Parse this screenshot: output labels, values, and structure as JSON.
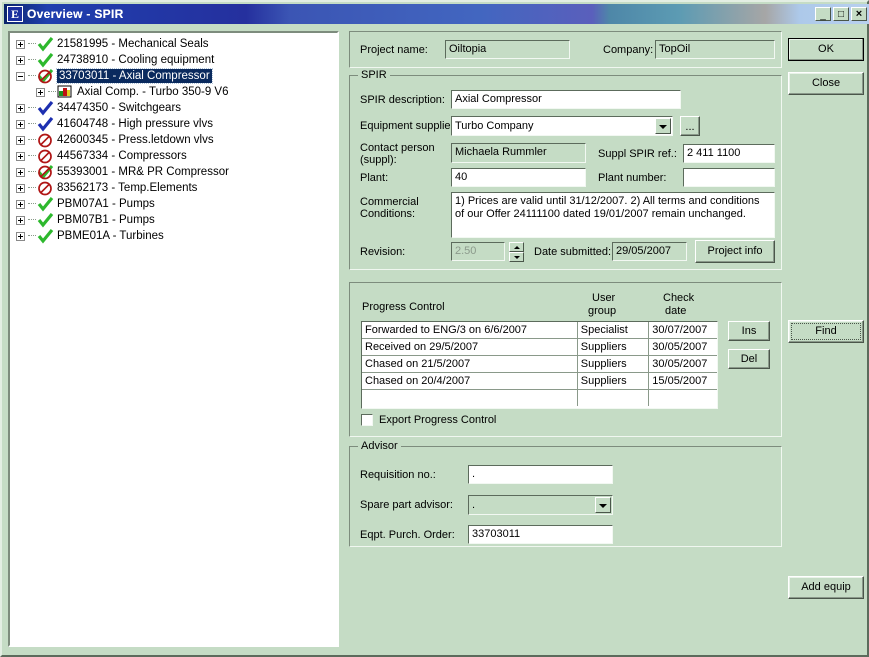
{
  "window": {
    "title": "Overview - SPIR",
    "icon": "e-document-icon",
    "controls": {
      "minimize": "_",
      "maximize": "□",
      "close": "×"
    }
  },
  "tree": {
    "items": [
      {
        "label": "21581995 - Mechanical Seals",
        "icon": "green-check-icon",
        "expander": "plus",
        "level": 0,
        "selected": false
      },
      {
        "label": "24738910 - Cooling equipment",
        "icon": "green-check-icon",
        "expander": "plus",
        "level": 0,
        "selected": false
      },
      {
        "label": "33703011 - Axial Compressor",
        "icon": "green-check-blocked-icon",
        "expander": "minus",
        "level": 0,
        "selected": true
      },
      {
        "label": "Axial Comp. - Turbo 350-9 V6",
        "icon": "color-chart-icon",
        "expander": "plus",
        "level": 1,
        "selected": false
      },
      {
        "label": "34474350 - Switchgears",
        "icon": "blue-check-icon",
        "expander": "plus",
        "level": 0,
        "selected": false
      },
      {
        "label": "41604748 - High pressure vlvs",
        "icon": "blue-check-icon",
        "expander": "plus",
        "level": 0,
        "selected": false
      },
      {
        "label": "42600345 - Press.letdown vlvs",
        "icon": "red-blocked-icon",
        "expander": "plus",
        "level": 0,
        "selected": false
      },
      {
        "label": "44567334 - Compressors",
        "icon": "red-blocked-icon",
        "expander": "plus",
        "level": 0,
        "selected": false
      },
      {
        "label": "55393001 - MR& PR Compressor",
        "icon": "green-check-blocked-icon",
        "expander": "plus",
        "level": 0,
        "selected": false
      },
      {
        "label": "83562173 - Temp.Elements",
        "icon": "red-blocked-icon",
        "expander": "plus",
        "level": 0,
        "selected": false
      },
      {
        "label": "PBM07A1 - Pumps",
        "icon": "green-check-icon",
        "expander": "plus",
        "level": 0,
        "selected": false
      },
      {
        "label": "PBM07B1 - Pumps",
        "icon": "green-check-icon",
        "expander": "plus",
        "level": 0,
        "selected": false
      },
      {
        "label": "PBME01A - Turbines",
        "icon": "green-check-icon",
        "expander": "plus",
        "level": 0,
        "selected": false
      }
    ]
  },
  "side_buttons": {
    "ok": "OK",
    "close": "Close",
    "find": "Find",
    "add_equip": "Add equip"
  },
  "header": {
    "project_name_label": "Project name:",
    "project_name_value": "Oiltopia",
    "company_label": "Company:",
    "company_value": "TopOil"
  },
  "spir": {
    "group_title": "SPIR",
    "description_label": "SPIR description:",
    "description_value": "Axial Compressor",
    "supplier_label": "Equipment supplier:",
    "supplier_value": "Turbo Company",
    "supplier_browse_label": "...",
    "contact_label_line1": "Contact person",
    "contact_label_line2": "(suppl):",
    "contact_value": "Michaela Rummler",
    "suppl_ref_label": "Suppl SPIR ref.:",
    "suppl_ref_value": "2 411 1100",
    "plant_label": "Plant:",
    "plant_value": "40",
    "plant_number_label": "Plant number:",
    "plant_number_value": "",
    "commercial_label_line1": "Commercial",
    "commercial_label_line2": "Conditions:",
    "commercial_value": "1) Prices are valid until 31/12/2007.  2) All terms and conditions of our Offer 24111100 dated 19/01/2007 remain unchanged.",
    "revision_label": "Revision:",
    "revision_value": "2.50",
    "date_submitted_label": "Date submitted:",
    "date_submitted_value": "29/05/2007",
    "project_info_button": "Project info"
  },
  "progress_control": {
    "title": "Progress Control",
    "col_user_group_line1": "User",
    "col_user_group_line2": "group",
    "col_check_date_line1": "Check",
    "col_check_date_line2": "date",
    "rows": [
      {
        "description": "Forwarded to ENG/3 on 6/6/2007",
        "user_group": "Specialist",
        "check_date": "30/07/2007"
      },
      {
        "description": "Received on 29/5/2007",
        "user_group": "Suppliers",
        "check_date": "30/05/2007"
      },
      {
        "description": "Chased on 21/5/2007",
        "user_group": "Suppliers",
        "check_date": "30/05/2007"
      },
      {
        "description": "Chased on 20/4/2007",
        "user_group": "Suppliers",
        "check_date": "15/05/2007"
      },
      {
        "description": "",
        "user_group": "",
        "check_date": ""
      }
    ],
    "ins_button": "Ins",
    "del_button": "Del",
    "export_checkbox_label": "Export Progress Control",
    "export_checkbox_checked": false
  },
  "advisor": {
    "group_title": "Advisor",
    "requisition_label": "Requisition no.:",
    "requisition_value": ".",
    "spare_part_label": "Spare part advisor:",
    "spare_part_value": ".",
    "purch_order_label": "Eqpt. Purch. Order:",
    "purch_order_value": "33703011"
  },
  "colors": {
    "window_face": "#c5dcc5",
    "title_start": "#0a246a",
    "title_end": "#b8d0ef",
    "selection": "#0a2a5e",
    "field_bg": "#ffffff",
    "icon_green": "#2db82d",
    "icon_blue": "#1d2fb0",
    "icon_red": "#b01515"
  }
}
